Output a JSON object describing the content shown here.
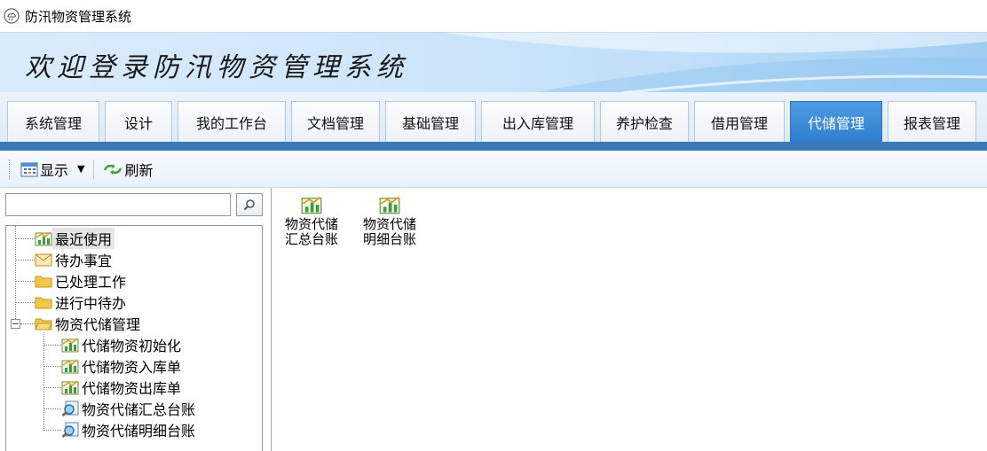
{
  "window": {
    "title": "防汛物资管理系统",
    "icon": "cloud-rain-app-icon"
  },
  "banner": {
    "title": "欢迎登录防汛物资管理系统"
  },
  "tabs": [
    {
      "label": "系统管理",
      "active": false
    },
    {
      "label": "设计",
      "active": false
    },
    {
      "label": "我的工作台",
      "active": false
    },
    {
      "label": "文档管理",
      "active": false
    },
    {
      "label": "基础管理",
      "active": false
    },
    {
      "label": "出入库管理",
      "active": false
    },
    {
      "label": "养护检查",
      "active": false
    },
    {
      "label": "借用管理",
      "active": false
    },
    {
      "label": "代储管理",
      "active": true
    },
    {
      "label": "报表管理",
      "active": false
    }
  ],
  "toolbar": {
    "display_label": "显示",
    "refresh_label": "刷新"
  },
  "search": {
    "value": "",
    "placeholder": ""
  },
  "tree": {
    "root_items": [
      {
        "label": "最近使用",
        "icon": "chart-sheet-icon"
      },
      {
        "label": "待办事宜",
        "icon": "mail-icon"
      },
      {
        "label": "已处理工作",
        "icon": "folder-icon"
      },
      {
        "label": "进行中待办",
        "icon": "folder-icon"
      },
      {
        "label": "物资代储管理",
        "icon": "folder-open-icon"
      }
    ],
    "children": [
      {
        "label": "代储物资初始化",
        "icon": "chart-sheet-icon"
      },
      {
        "label": "代储物资入库单",
        "icon": "chart-sheet-icon"
      },
      {
        "label": "代储物资出库单",
        "icon": "chart-sheet-icon"
      },
      {
        "label": "物资代储汇总台账",
        "icon": "report-search-icon"
      },
      {
        "label": "物资代储明细台账",
        "icon": "report-search-icon"
      }
    ]
  },
  "content": {
    "items": [
      {
        "label": "物资代储汇总台账",
        "icon": "chart-sheet-icon"
      },
      {
        "label": "物资代储明细台账",
        "icon": "chart-sheet-icon"
      }
    ]
  },
  "colors": {
    "active_tab": "#3d8ad8",
    "tab_bar": "#3a78b8",
    "banner": "#cfe6fa"
  }
}
